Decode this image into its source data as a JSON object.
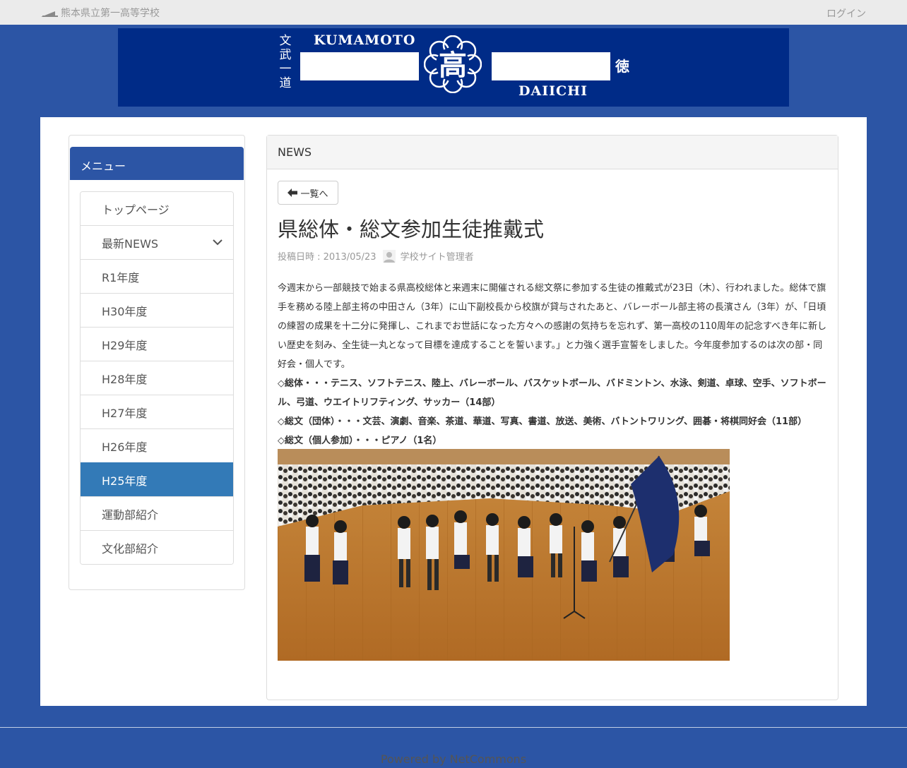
{
  "header": {
    "site_title": "熊本県立第一高等学校",
    "login_label": "ログイン"
  },
  "banner": {
    "word_top": "KUMAMOTO",
    "word_bottom": "DAIICHI",
    "vertical_left": "文武一道",
    "vertical_right": "徳",
    "emblem_char": "高"
  },
  "sidebar": {
    "heading": "メニュー",
    "items": [
      {
        "label": "トップページ"
      },
      {
        "label": "最新NEWS"
      },
      {
        "label": "R1年度"
      },
      {
        "label": "H30年度"
      },
      {
        "label": "H29年度"
      },
      {
        "label": "H28年度"
      },
      {
        "label": "H27年度"
      },
      {
        "label": "H26年度"
      },
      {
        "label": "H25年度"
      },
      {
        "label": "運動部紹介"
      },
      {
        "label": "文化部紹介"
      }
    ],
    "active_item": "H25年度"
  },
  "content": {
    "panel_title": "NEWS",
    "back_label": "一覧へ",
    "article_title": "県総体・総文参加生徒推戴式",
    "posted_label": "投稿日時 : 2013/05/23",
    "author": "学校サイト管理者",
    "paragraph": "今週末から一部競技で始まる県高校総体と来週末に開催される総文祭に参加する生徒の推戴式が23日（木）、行われました。総体で旗手を務める陸上部主将の中田さん（3年）に山下副校長から校旗が貸与されたあと、バレーボール部主将の長濱さん（3年）が、「日頃の練習の成果を十二分に発揮し、これまでお世話になった方々への感謝の気持ちを忘れず、第一高校の110周年の記念すべき年に新しい歴史を刻み、全生徒一丸となって目標を達成することを誓います。」と力強く選手宣誓をしました。今年度参加するのは次の部・同好会・個人です。",
    "line_sports": "◇総体・・・テニス、ソフトテニス、陸上、バレーボール、バスケットボール、バドミントン、水泳、剣道、卓球、空手、ソフトボール、弓道、ウエイトリフティング、サッカー（14部）",
    "line_culture_group": "◇総文（団体）・・・文芸、演劇、音楽、茶道、華道、写真、書道、放送、美術、バトントワリング、囲碁・将棋同好会（11部）",
    "line_culture_individual": "◇総文（個人参加）・・・ピアノ（1名）"
  },
  "footer": {
    "powered_by": "Powered by NetCommons"
  },
  "colors": {
    "page_bg": "#2c55a5",
    "banner_bg": "#002b87",
    "active_item": "#337ab7"
  }
}
